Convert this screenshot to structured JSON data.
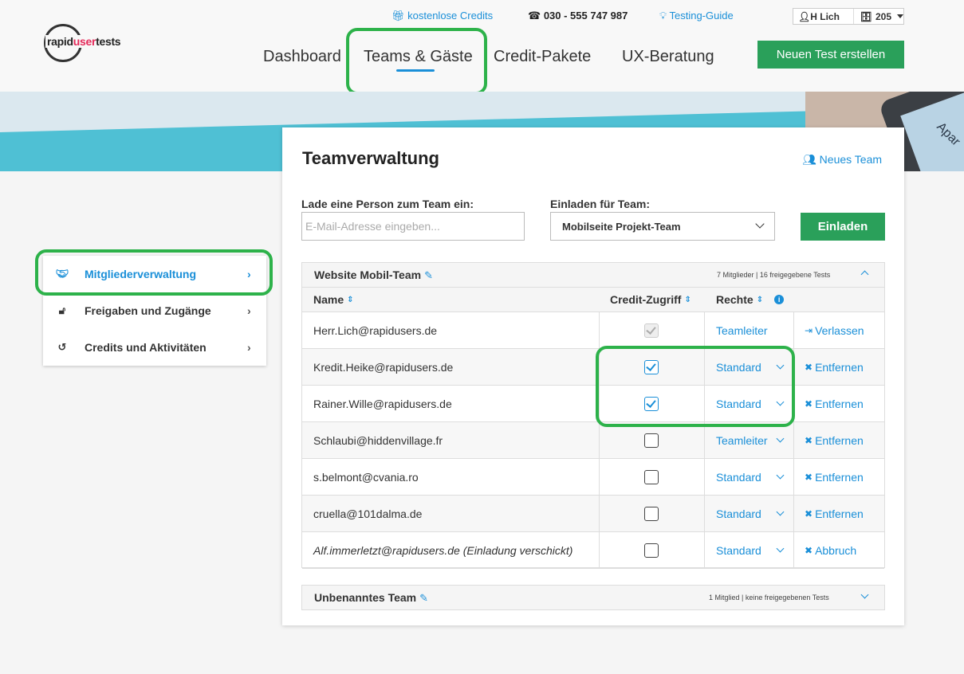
{
  "brand": {
    "logo_part1": "rapid",
    "logo_part2": "user",
    "logo_part3": "tests"
  },
  "topbar": {
    "credits_link": "kostenlose Credits",
    "phone": "030 - 555 747 987",
    "guide_link": "Testing-Guide",
    "user_name": "H Lich",
    "credit_count": "205"
  },
  "nav": {
    "items": [
      "Dashboard",
      "Teams & Gäste",
      "Credit-Pakete",
      "UX-Beratung"
    ],
    "new_test_button": "Neuen Test erstellen"
  },
  "banner": {
    "device_text": "Apar"
  },
  "sidebar": {
    "items": [
      {
        "label": "Mitgliederverwaltung",
        "icon": "handshake-icon",
        "active": true
      },
      {
        "label": "Freigaben und Zugänge",
        "icon": "unlock-icon",
        "active": false
      },
      {
        "label": "Credits und Aktivitäten",
        "icon": "history-icon",
        "active": false
      }
    ]
  },
  "main": {
    "title": "Teamverwaltung",
    "new_team_link": "Neues Team",
    "invite_label": "Lade eine Person zum Team ein:",
    "email_placeholder": "E-Mail-Adresse eingeben...",
    "team_select_label": "Einladen für Team:",
    "team_select_value": "Mobilseite Projekt-Team",
    "invite_button": "Einladen"
  },
  "teams": [
    {
      "name": "Website Mobil-Team",
      "meta": "7 Mitglieder | 16 freigegebene Tests",
      "expanded": true,
      "columns": {
        "name": "Name",
        "credit": "Credit-Zugriff",
        "rights": "Rechte"
      },
      "members": [
        {
          "email": "Herr.Lich@rapidusers.de",
          "credit_access": true,
          "disabled": true,
          "rights": "Teamleiter",
          "rights_dropdown": false,
          "action": "Verlassen",
          "action_icon": "sign-out-icon",
          "italic": false
        },
        {
          "email": "Kredit.Heike@rapidusers.de",
          "credit_access": true,
          "disabled": false,
          "rights": "Standard",
          "rights_dropdown": true,
          "action": "Entfernen",
          "action_icon": "user-remove-icon",
          "italic": false
        },
        {
          "email": "Rainer.Wille@rapidusers.de",
          "credit_access": true,
          "disabled": false,
          "rights": "Standard",
          "rights_dropdown": true,
          "action": "Entfernen",
          "action_icon": "user-remove-icon",
          "italic": false
        },
        {
          "email": "Schlaubi@hiddenvillage.fr",
          "credit_access": false,
          "disabled": false,
          "rights": "Teamleiter",
          "rights_dropdown": true,
          "action": "Entfernen",
          "action_icon": "user-remove-icon",
          "italic": false
        },
        {
          "email": "s.belmont@cvania.ro",
          "credit_access": false,
          "disabled": false,
          "rights": "Standard",
          "rights_dropdown": true,
          "action": "Entfernen",
          "action_icon": "user-remove-icon",
          "italic": false
        },
        {
          "email": "cruella@101dalma.de",
          "credit_access": false,
          "disabled": false,
          "rights": "Standard",
          "rights_dropdown": true,
          "action": "Entfernen",
          "action_icon": "user-remove-icon",
          "italic": false
        },
        {
          "email": "Alf.immerletzt@rapidusers.de (Einladung verschickt)",
          "credit_access": false,
          "disabled": false,
          "rights": "Standard",
          "rights_dropdown": true,
          "action": "Abbruch",
          "action_icon": "user-remove-icon",
          "italic": true
        }
      ]
    },
    {
      "name": "Unbenanntes Team",
      "meta": "1 Mitglied | keine freigegebenen Tests",
      "expanded": false
    }
  ],
  "colors": {
    "accent": "#1a8fd8",
    "primary_button": "#2aa05a",
    "highlight": "#2db24a",
    "brand_red": "#e52a5a"
  }
}
